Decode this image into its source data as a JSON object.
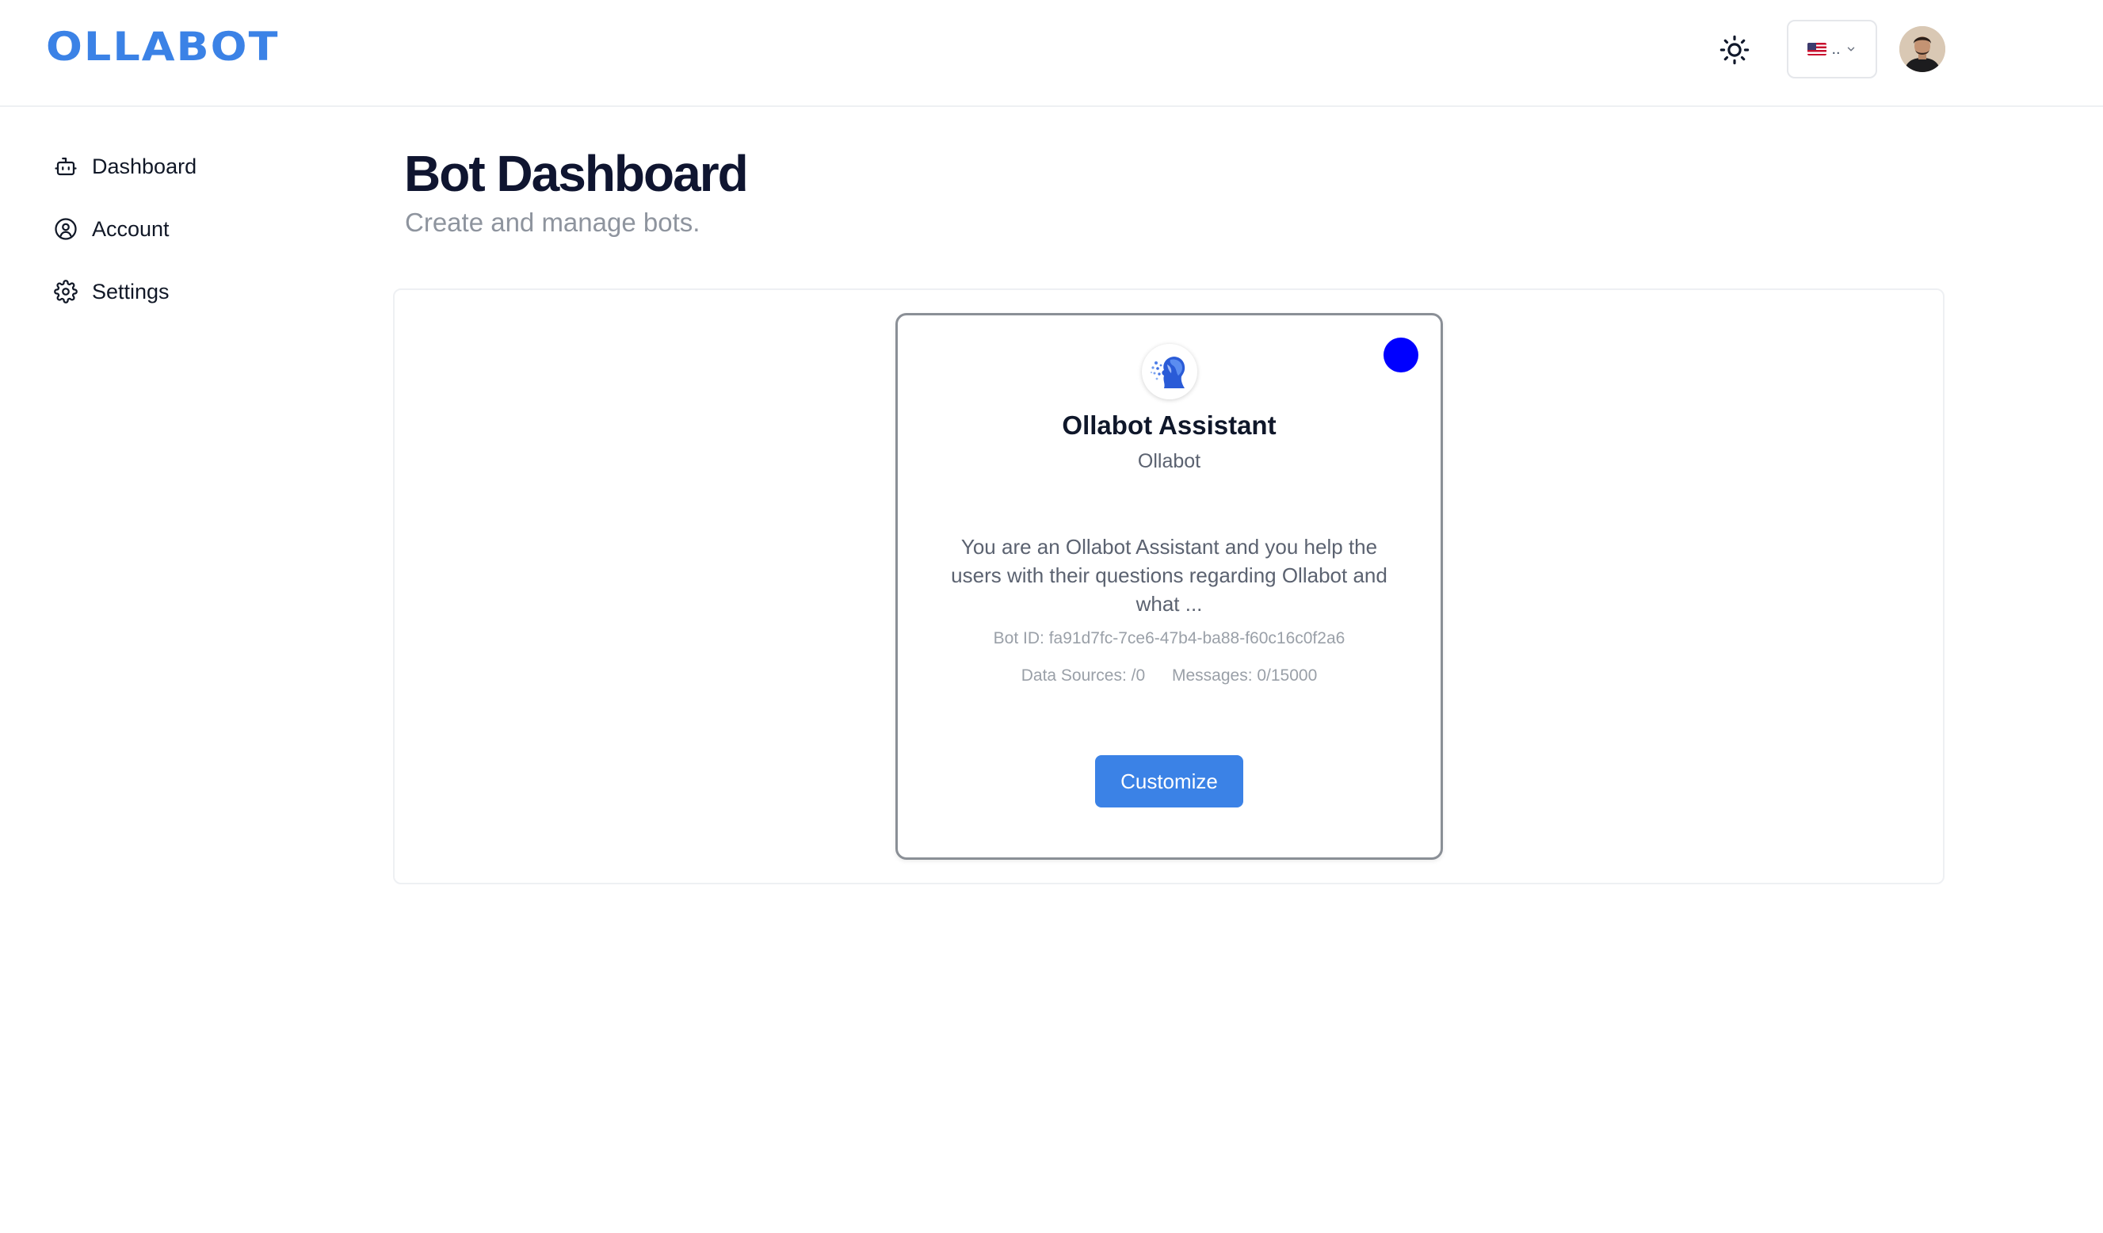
{
  "brand": {
    "logo_text": "OLLABOT",
    "accent_color": "#3b82e6"
  },
  "header": {
    "theme_icon": "sun-icon",
    "language": {
      "flag_icon": "us-flag-icon",
      "selected_label": "..",
      "chevron_icon": "chevron-down-icon"
    },
    "avatar_icon": "user-avatar"
  },
  "sidebar": {
    "items": [
      {
        "label": "Dashboard",
        "icon": "bot-icon"
      },
      {
        "label": "Account",
        "icon": "user-circle-icon"
      },
      {
        "label": "Settings",
        "icon": "gear-icon"
      }
    ]
  },
  "main": {
    "title": "Bot Dashboard",
    "subtitle": "Create and manage bots."
  },
  "bot_card": {
    "status_color": "#0000ff",
    "logo_icon": "ollabot-head-logo",
    "name": "Ollabot Assistant",
    "organization": "Ollabot",
    "description": "You are an Ollabot Assistant and you help the users with their questions regarding Ollabot and what ...",
    "bot_id": "Bot ID: fa91d7fc-7ce6-47b4-ba88-f60c16c0f2a6",
    "data_sources": "Data Sources: /0",
    "messages": "Messages: 0/15000",
    "customize_label": "Customize"
  }
}
